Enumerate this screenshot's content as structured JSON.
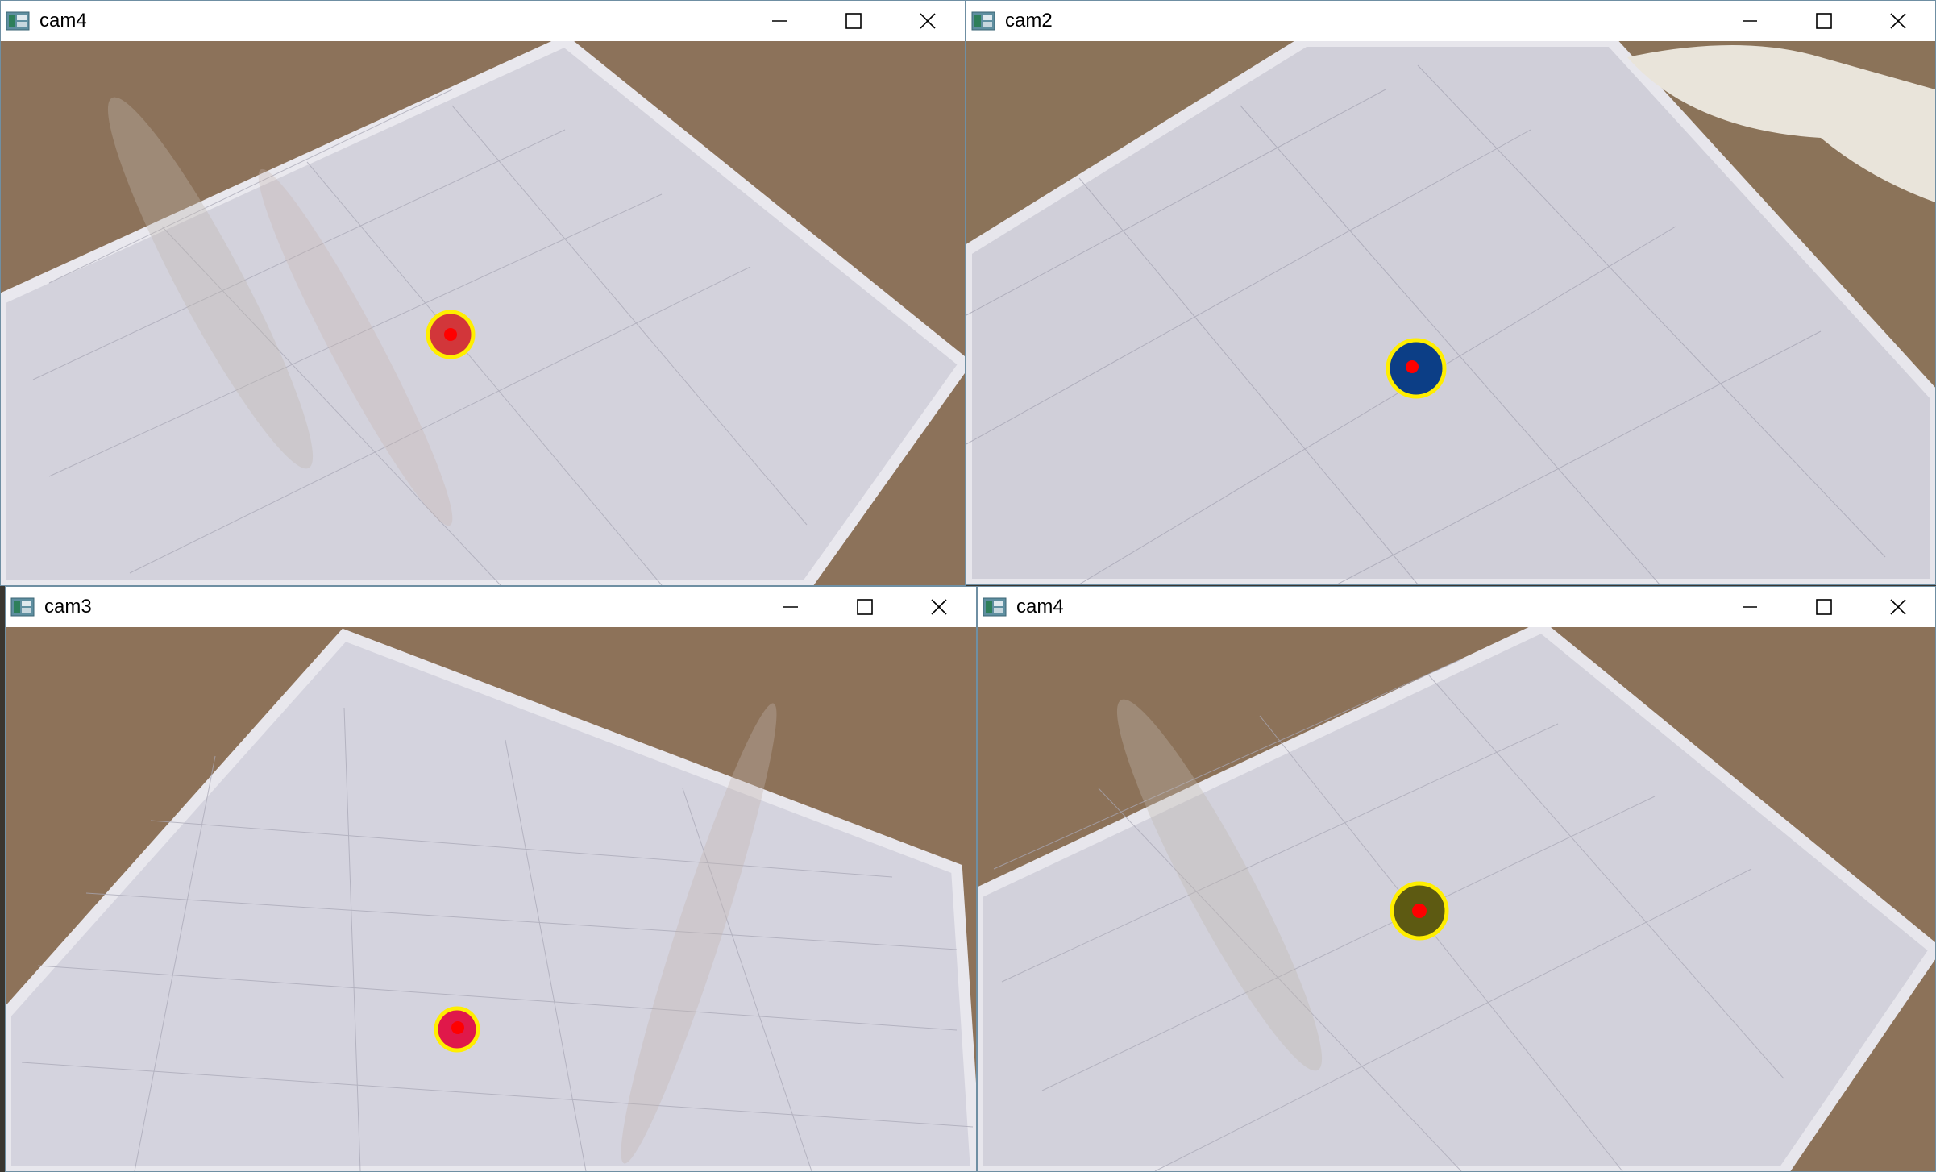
{
  "windows": [
    {
      "title": "cam4",
      "detection": {
        "ball_color": "#d2363a",
        "ring_color": "#ffee00",
        "center_color": "#ff0000"
      }
    },
    {
      "title": "cam2",
      "detection": {
        "ball_color": "#0c3e86",
        "ring_color": "#ffee00",
        "center_color": "#ff0000"
      }
    },
    {
      "title": "cam3",
      "detection": {
        "ball_color": "#e0184a",
        "ring_color": "#ffee00",
        "center_color": "#ff0000"
      }
    },
    {
      "title": "cam4",
      "detection": {
        "ball_color": "#5d5a12",
        "ring_color": "#ffee00",
        "center_color": "#ff0000"
      }
    }
  ],
  "icons": {
    "app": "app-window-icon",
    "minimize": "minimize-icon",
    "maximize": "maximize-icon",
    "close": "close-icon"
  },
  "colors": {
    "floor": "#8c725a",
    "board": "#d3d2dc",
    "frame": "#e6e5ea",
    "grid": "#a9a8b6",
    "window_border": "#6f8fa3"
  }
}
